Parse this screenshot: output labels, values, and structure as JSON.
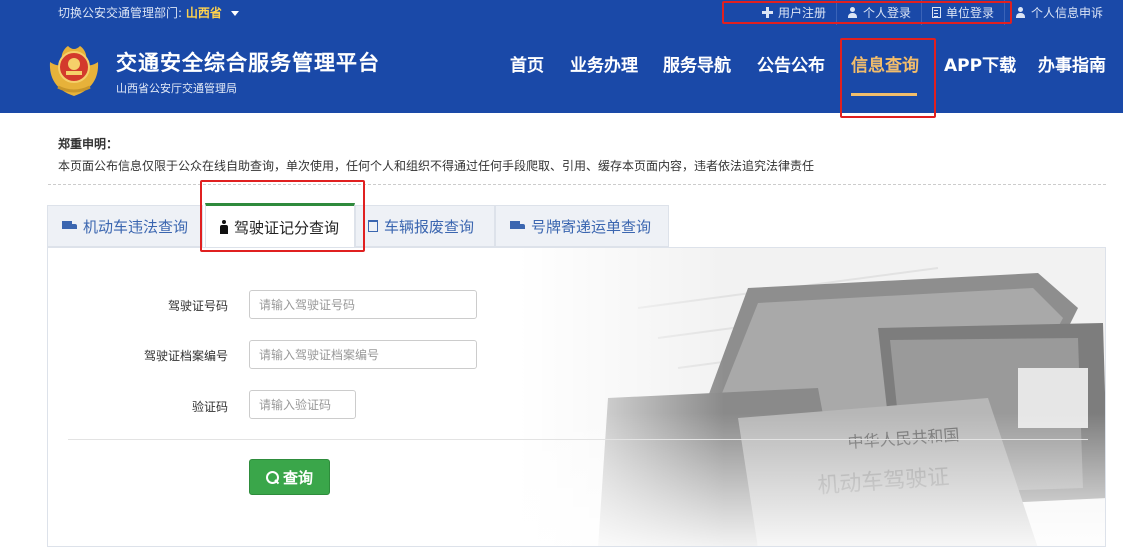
{
  "topbar": {
    "region_label": "切换公安交通管理部门:",
    "province": "山西省",
    "links": [
      "用户注册",
      "个人登录",
      "单位登录",
      "个人信息申诉"
    ]
  },
  "header": {
    "title": "交通安全综合服务管理平台",
    "subtitle": "山西省公安厅交通管理局",
    "nav": [
      "首页",
      "业务办理",
      "服务导航",
      "公告公布",
      "信息查询",
      "APP下载",
      "办事指南"
    ],
    "active_nav": "信息查询"
  },
  "statement": {
    "title": "郑重申明：",
    "text": "本页面公布信息仅限于公众在线自助查询，单次使用，任何个人和组织不得通过任何手段爬取、引用、缓存本页面内容，违者依法追究法律责任"
  },
  "tabs": [
    "机动车违法查询",
    "驾驶证记分查询",
    "车辆报废查询",
    "号牌寄递运单查询"
  ],
  "active_tab": "驾驶证记分查询",
  "form": {
    "license_no_label": "驾驶证号码",
    "license_no_placeholder": "请输入驾驶证号码",
    "license_file_label": "驾驶证档案编号",
    "license_file_placeholder": "请输入驾驶证档案编号",
    "captcha_label": "验证码",
    "captcha_placeholder": "请输入验证码",
    "submit_label": "查询"
  },
  "colors": {
    "header_bg": "#1a49a8",
    "nav_active": "#f2bd6b",
    "button_green": "#3aa64a",
    "highlight_red": "#e02020"
  }
}
